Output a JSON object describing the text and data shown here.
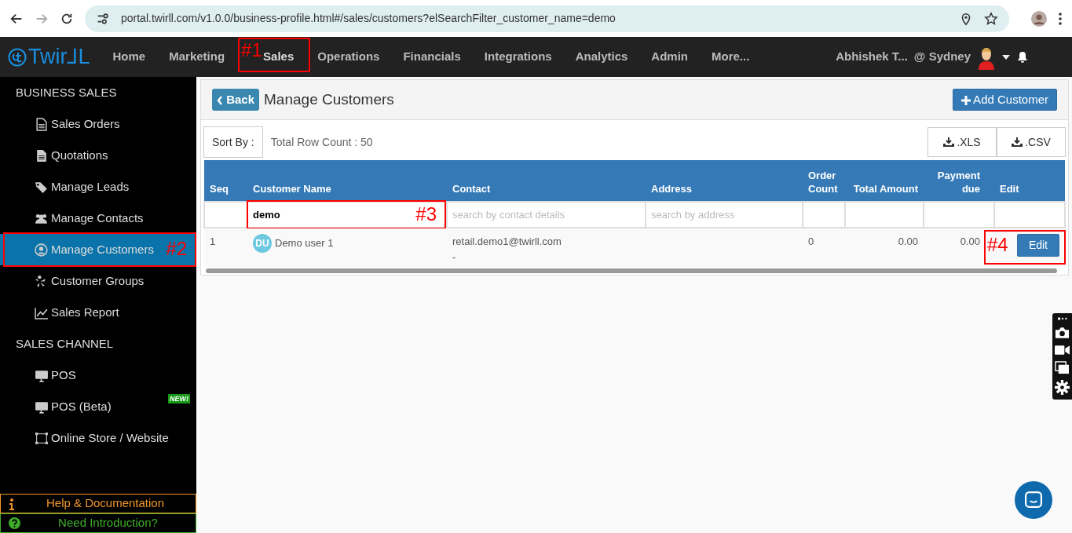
{
  "browser": {
    "url": "portal.twirll.com/v1.0.0/business-profile.html#/sales/customers?elSearchFilter_customer_name=demo"
  },
  "navbar": {
    "logo": "Twir⅃L",
    "items": [
      {
        "label": "Home",
        "selected": false
      },
      {
        "label": "Marketing",
        "selected": false
      },
      {
        "label": "Sales",
        "selected": true,
        "annotation": "#1"
      },
      {
        "label": "Operations",
        "selected": false
      },
      {
        "label": "Financials",
        "selected": false
      },
      {
        "label": "Integrations",
        "selected": false
      },
      {
        "label": "Analytics",
        "selected": false
      },
      {
        "label": "Admin",
        "selected": false
      },
      {
        "label": "More...",
        "selected": false
      }
    ],
    "user": "Abhishek T...",
    "location": "@ Sydney"
  },
  "sidebar": {
    "sections": [
      {
        "title": "BUSINESS SALES",
        "items": [
          {
            "label": "Sales Orders",
            "selected": false
          },
          {
            "label": "Quotations",
            "selected": false
          },
          {
            "label": "Manage Leads",
            "selected": false
          },
          {
            "label": "Manage Contacts",
            "selected": false
          },
          {
            "label": "Manage Customers",
            "selected": true,
            "annotation": "#2"
          },
          {
            "label": "Customer Groups",
            "selected": false
          },
          {
            "label": "Sales Report",
            "selected": false
          }
        ]
      },
      {
        "title": "SALES CHANNEL",
        "items": [
          {
            "label": "POS",
            "selected": false
          },
          {
            "label": "POS (Beta)",
            "selected": false,
            "badge": "NEW!"
          },
          {
            "label": "Online Store / Website",
            "selected": false
          }
        ]
      }
    ],
    "footer": [
      {
        "label": "Help & Documentation",
        "color": "#f0962a"
      },
      {
        "label": "Need Introduction?",
        "color": "#3fae2a"
      }
    ]
  },
  "page": {
    "back": "Back",
    "title": "Manage Customers",
    "add": "Add Customer",
    "sort_by": "Sort By :",
    "row_count": "Total Row Count : 50",
    "exports": [
      ".XLS",
      ".CSV"
    ]
  },
  "table": {
    "columns": [
      {
        "label": "Seq"
      },
      {
        "label": "Customer Name"
      },
      {
        "label": "Contact"
      },
      {
        "label": "Address"
      },
      {
        "label": "Order Count"
      },
      {
        "label": "Total Amount"
      },
      {
        "label": "Payment due"
      },
      {
        "label": "Edit"
      }
    ],
    "filters": [
      {
        "kind": "none"
      },
      {
        "kind": "input",
        "value": "demo",
        "annotation": "#3"
      },
      {
        "kind": "input",
        "placeholder": "search by contact details"
      },
      {
        "kind": "input",
        "placeholder": "search by address"
      },
      {
        "kind": "input"
      },
      {
        "kind": "input"
      },
      {
        "kind": "input"
      },
      {
        "kind": "input"
      }
    ],
    "rows": [
      {
        "seq": "1",
        "initials": "DU",
        "name": "Demo user 1",
        "contact": [
          "retail.demo1@twirll.com",
          "-"
        ],
        "order_count": "0",
        "total": "0.00",
        "payment_due": "0.00",
        "edit": "Edit",
        "annotation": "#4"
      }
    ]
  }
}
